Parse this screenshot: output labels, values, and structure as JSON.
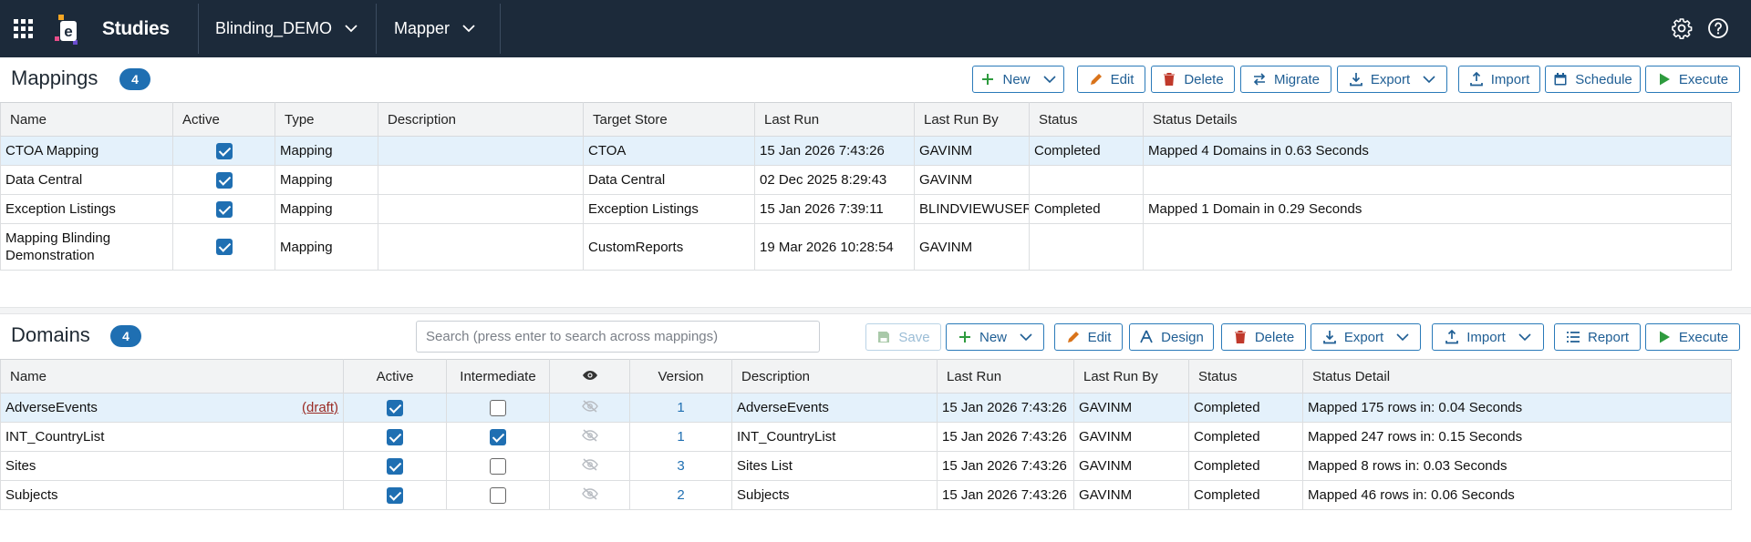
{
  "topbar": {
    "app_title": "Studies",
    "study_dropdown": "Blinding_DEMO",
    "module_dropdown": "Mapper",
    "icons": [
      "apps-grid-icon",
      "logo-icon",
      "gear-icon",
      "help-icon"
    ]
  },
  "mappings": {
    "title": "Mappings",
    "count": "4",
    "toolbar": {
      "new": "New",
      "edit": "Edit",
      "delete": "Delete",
      "migrate": "Migrate",
      "export": "Export",
      "import": "Import",
      "schedule": "Schedule",
      "execute": "Execute"
    },
    "columns": [
      "Name",
      "Active",
      "Type",
      "Description",
      "Target Store",
      "Last Run",
      "Last Run By",
      "Status",
      "Status Details"
    ],
    "rows": [
      {
        "name": "CTOA Mapping",
        "active": true,
        "type": "Mapping",
        "description": "",
        "target_store": "CTOA",
        "last_run": "15 Jan 2026 7:43:26",
        "last_run_by": "GAVINM",
        "status": "Completed",
        "status_details": "Mapped 4 Domains in 0.63 Seconds"
      },
      {
        "name": "Data Central",
        "active": true,
        "type": "Mapping",
        "description": "",
        "target_store": "Data Central",
        "last_run": "02 Dec 2025 8:29:43",
        "last_run_by": "GAVINM",
        "status": "",
        "status_details": ""
      },
      {
        "name": "Exception Listings",
        "active": true,
        "type": "Mapping",
        "description": "",
        "target_store": "Exception Listings",
        "last_run": "15 Jan 2026 7:39:11",
        "last_run_by": "BLINDVIEWUSER",
        "status": "Completed",
        "status_details": "Mapped 1 Domain in 0.29 Seconds"
      },
      {
        "name": "Mapping Blinding Demonstration",
        "active": true,
        "type": "Mapping",
        "description": "",
        "target_store": "CustomReports",
        "last_run": "19 Mar 2026 10:28:54",
        "last_run_by": "GAVINM",
        "status": "",
        "status_details": ""
      }
    ]
  },
  "domains": {
    "title": "Domains",
    "count": "4",
    "search_placeholder": "Search (press enter to search across mappings)",
    "toolbar": {
      "save": "Save",
      "new": "New",
      "edit": "Edit",
      "design": "Design",
      "delete": "Delete",
      "export": "Export",
      "import": "Import",
      "report": "Report",
      "execute": "Execute"
    },
    "columns": [
      "Name",
      "Active",
      "Intermediate",
      "",
      "Version",
      "Description",
      "Last Run",
      "Last Run By",
      "Status",
      "Status Detail"
    ],
    "draft_label": "(draft)",
    "rows": [
      {
        "name": "AdverseEvents",
        "draft": true,
        "active": true,
        "intermediate": false,
        "version": "1",
        "description": "AdverseEvents",
        "last_run": "15 Jan 2026 7:43:26",
        "last_run_by": "GAVINM",
        "status": "Completed",
        "status_detail": "Mapped 175 rows in: 0.04 Seconds"
      },
      {
        "name": "INT_CountryList",
        "draft": false,
        "active": true,
        "intermediate": true,
        "version": "1",
        "description": "INT_CountryList",
        "last_run": "15 Jan 2026 7:43:26",
        "last_run_by": "GAVINM",
        "status": "Completed",
        "status_detail": "Mapped 247 rows in: 0.15 Seconds"
      },
      {
        "name": "Sites",
        "draft": false,
        "active": true,
        "intermediate": false,
        "version": "3",
        "description": "Sites List",
        "last_run": "15 Jan 2026 7:43:26",
        "last_run_by": "GAVINM",
        "status": "Completed",
        "status_detail": "Mapped 8 rows in: 0.03 Seconds"
      },
      {
        "name": "Subjects",
        "draft": false,
        "active": true,
        "intermediate": false,
        "version": "2",
        "description": "Subjects",
        "last_run": "15 Jan 2026 7:43:26",
        "last_run_by": "GAVINM",
        "status": "Completed",
        "status_detail": "Mapped 46 rows in: 0.06 Seconds"
      }
    ]
  },
  "colors": {
    "topbar": "#1c2a3a",
    "accent": "#1f6fb2",
    "delete": "#c0392b",
    "execute": "#2e9b3e",
    "selected_row": "#e4f1fb"
  }
}
